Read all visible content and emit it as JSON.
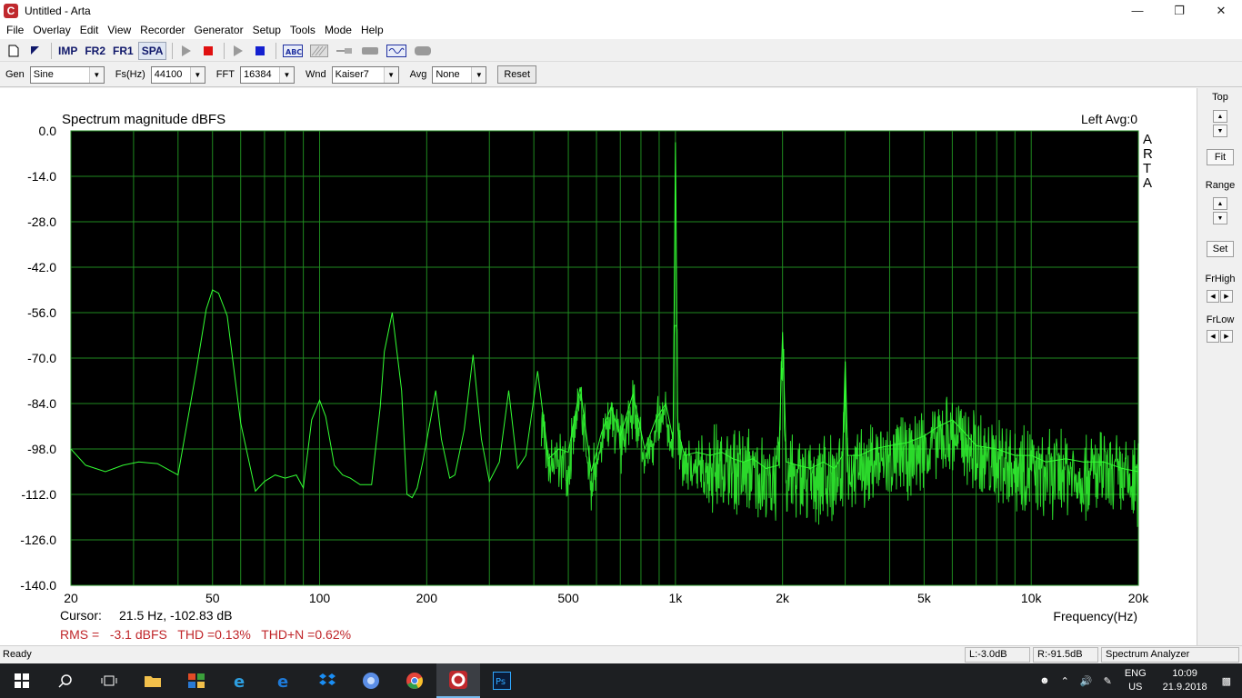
{
  "window": {
    "title": "Untitled - Arta",
    "app_icon_letter": "C"
  },
  "menu": [
    "File",
    "Overlay",
    "Edit",
    "View",
    "Recorder",
    "Generator",
    "Setup",
    "Tools",
    "Mode",
    "Help"
  ],
  "toolbar": {
    "imp": "IMP",
    "fr2": "FR2",
    "fr1": "FR1",
    "spa": "SPA",
    "abc": "ABC"
  },
  "controls": {
    "gen_label": "Gen",
    "gen_value": "Sine",
    "fs_label": "Fs(Hz)",
    "fs_value": "44100",
    "fft_label": "FFT",
    "fft_value": "16384",
    "wnd_label": "Wnd",
    "wnd_value": "Kaiser7",
    "avg_label": "Avg",
    "avg_value": "None",
    "reset_label": "Reset"
  },
  "side_panel": {
    "top_label": "Top",
    "fit_label": "Fit",
    "range_label": "Range",
    "set_label": "Set",
    "frhigh_label": "FrHigh",
    "frlow_label": "FrLow"
  },
  "plot": {
    "channel_info": "Left  Avg:0",
    "cursor_label": "Cursor:",
    "cursor_value": "21.5 Hz, -102.83 dB",
    "stats": "RMS =   -3.1 dBFS   THD =0.13%   THD+N =0.62%",
    "vertical_brand": "ARTA"
  },
  "chart_data": {
    "type": "line",
    "title": "Spectrum magnitude dBFS",
    "xlabel": "Frequency(Hz)",
    "ylabel": "",
    "x_scale": "log",
    "xlim": [
      20,
      20000
    ],
    "ylim": [
      -140,
      0
    ],
    "y_ticks": [
      "0.0",
      "-14.0",
      "-28.0",
      "-42.0",
      "-56.0",
      "-70.0",
      "-84.0",
      "-98.0",
      "-112.0",
      "-126.0",
      "-140.0"
    ],
    "x_ticks": [
      {
        "value": 20,
        "label": "20"
      },
      {
        "value": 50,
        "label": "50"
      },
      {
        "value": 100,
        "label": "100"
      },
      {
        "value": 200,
        "label": "200"
      },
      {
        "value": 500,
        "label": "500"
      },
      {
        "value": 1000,
        "label": "1k"
      },
      {
        "value": 2000,
        "label": "2k"
      },
      {
        "value": 5000,
        "label": "5k"
      },
      {
        "value": 10000,
        "label": "10k"
      },
      {
        "value": 20000,
        "label": "20k"
      }
    ],
    "grid": true,
    "background": "#000000",
    "grid_color": "#1f8a1f",
    "line_color": "#33ff33",
    "series": [
      {
        "x": [
          20,
          22,
          25,
          28,
          31,
          35,
          40,
          45,
          48,
          50,
          52,
          55,
          60,
          66,
          70,
          75,
          80,
          86,
          90,
          95,
          100,
          104,
          110,
          116,
          122,
          130,
          140,
          148,
          152,
          160,
          170,
          176,
          182,
          188,
          195,
          205,
          212,
          220,
          232,
          240,
          255,
          270,
          285,
          300,
          320,
          340,
          360,
          380,
          410,
          440,
          470,
          500,
          540,
          580,
          620,
          660,
          700,
          760,
          820,
          880,
          940,
          985,
          1000,
          1015,
          1060,
          1150,
          1250,
          1350,
          1450,
          1550,
          1650,
          1800,
          1950,
          2000,
          2050,
          2200,
          2400,
          2600,
          2800,
          2950,
          3000,
          3050,
          3300,
          3600,
          4000,
          4500,
          5000,
          5500,
          6000,
          6500,
          7000,
          8000,
          9000,
          10000,
          11000,
          12500,
          14000,
          16000,
          18000,
          20000
        ],
        "y": [
          -98,
          -103,
          -105,
          -103,
          -102,
          -102.5,
          -106,
          -74,
          -55,
          -49,
          -50,
          -57,
          -90,
          -111,
          -108,
          -106,
          -107,
          -106,
          -110,
          -89,
          -83,
          -88,
          -103,
          -106,
          -107,
          -109,
          -109,
          -85,
          -68,
          -56,
          -80,
          -112,
          -113,
          -110,
          -102,
          -89,
          -80,
          -95,
          -107,
          -106,
          -92,
          -69,
          -95,
          -108,
          -102,
          -80,
          -104,
          -100,
          -74,
          -101,
          -98,
          -99,
          -79,
          -105,
          -93,
          -85,
          -94,
          -81,
          -98,
          -89,
          -84,
          -95,
          -3.5,
          -92,
          -100,
          -99,
          -100,
          -99,
          -101,
          -102,
          -101,
          -104,
          -103,
          -62,
          -102,
          -103,
          -104,
          -102,
          -104,
          -100,
          -71,
          -100,
          -100,
          -98,
          -97,
          -96,
          -94,
          -91,
          -89,
          -93,
          -97,
          -98,
          -100,
          -100,
          -102,
          -101,
          -102,
          -102,
          -104,
          -105
        ]
      }
    ]
  },
  "status": {
    "ready": "Ready",
    "left_level": "L:-3.0dB",
    "right_level": "R:-91.5dB",
    "mode": "Spectrum Analyzer"
  },
  "taskbar": {
    "lang_top": "ENG",
    "lang_bottom": "US",
    "time": "10:09",
    "date": "21.9.2018",
    "ps_label": "Ps"
  }
}
